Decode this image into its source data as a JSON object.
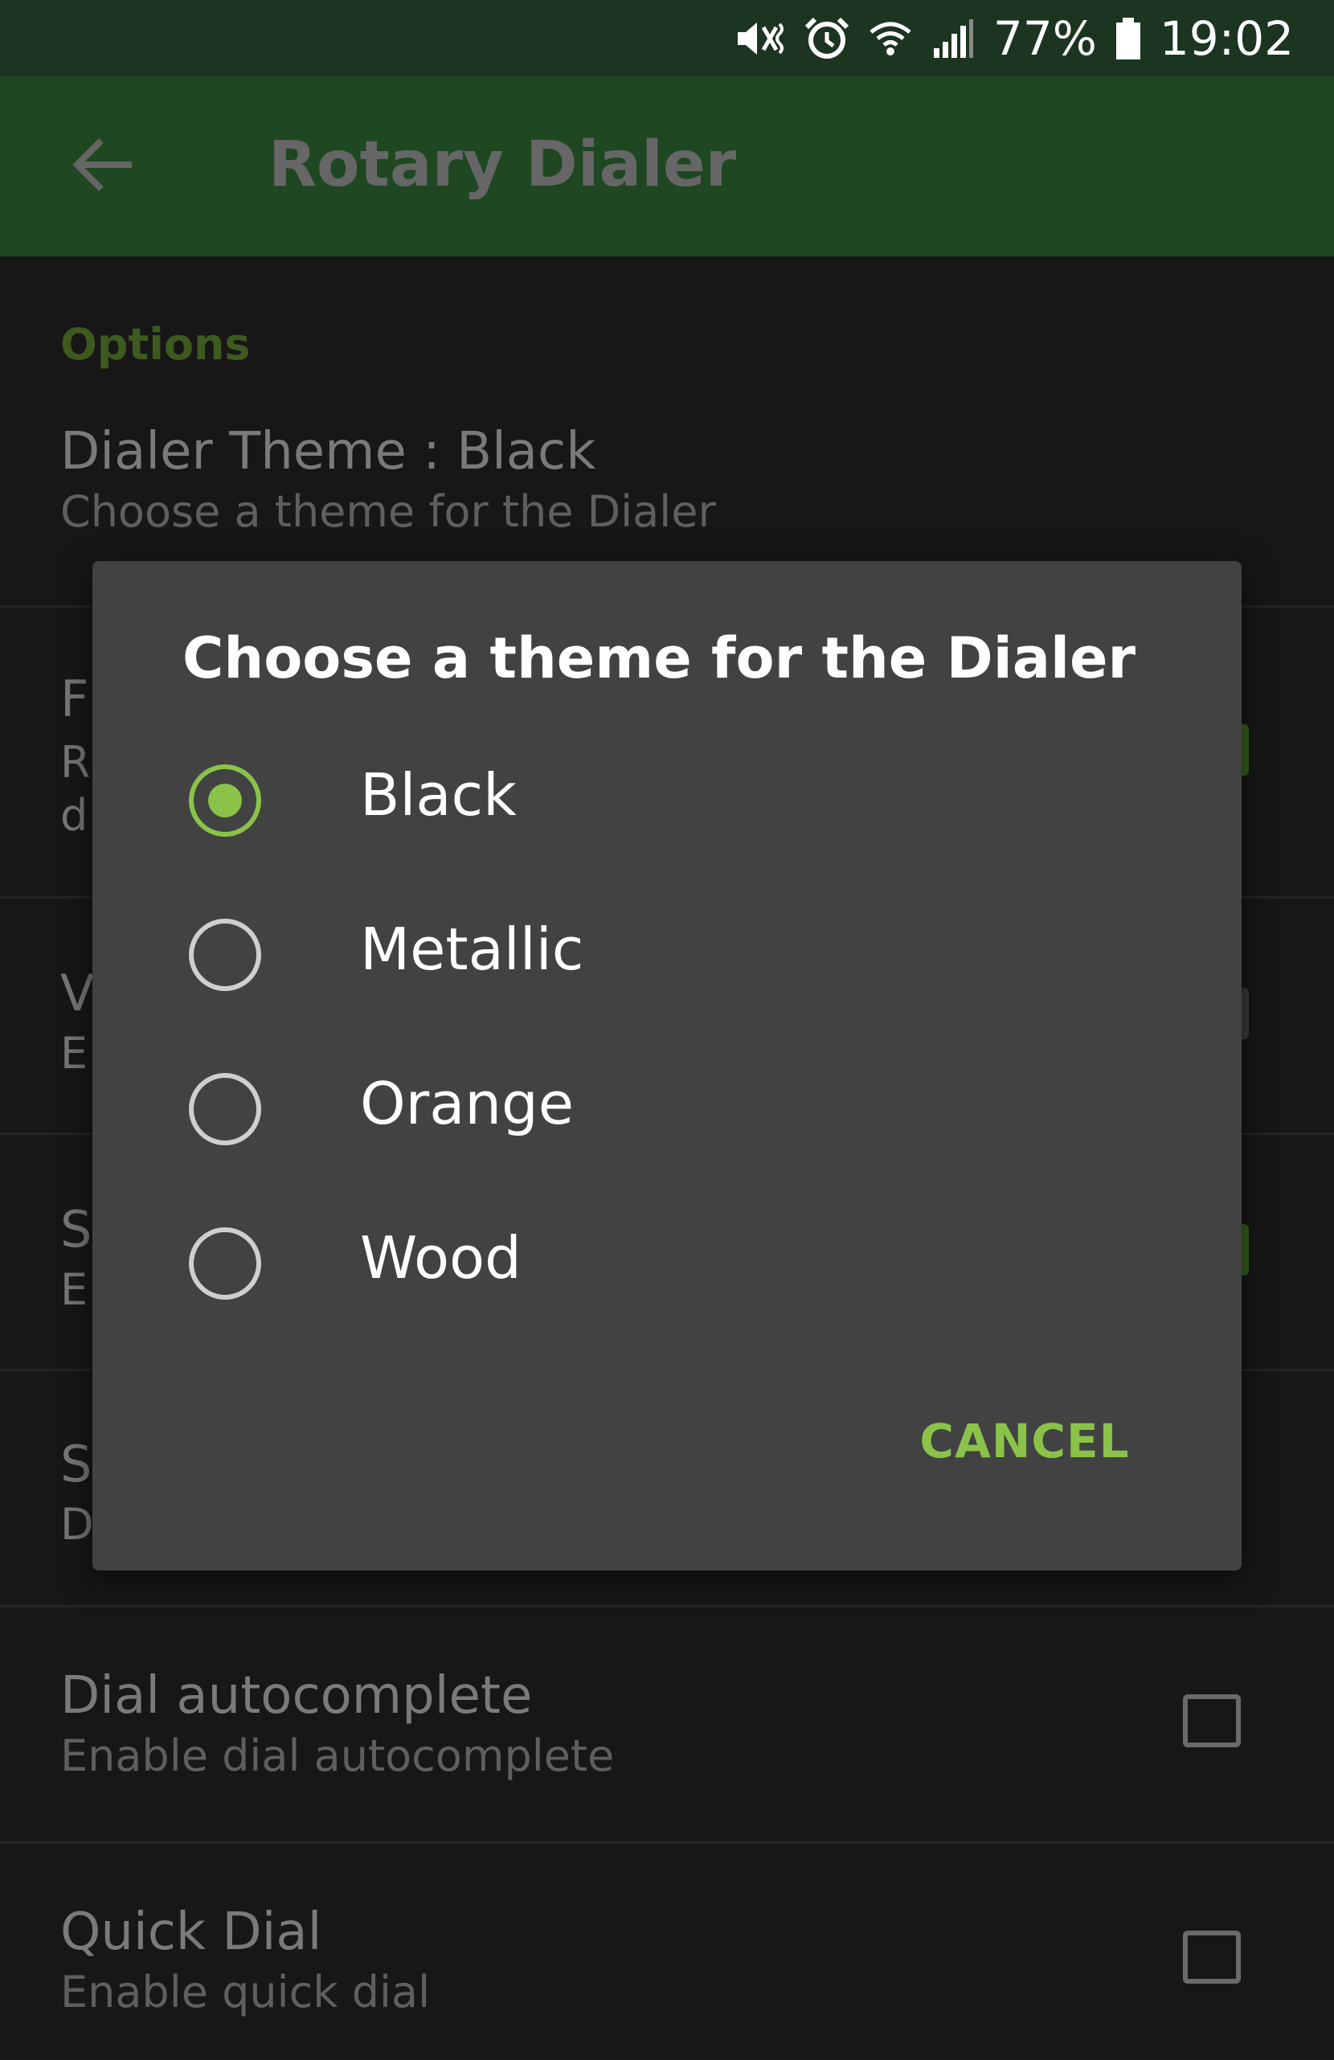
{
  "status_bar": {
    "icons": [
      "mute-vibrate-icon",
      "alarm-icon",
      "wifi-icon",
      "signal-icon",
      "battery-icon"
    ],
    "battery": "77%",
    "time": "19:02"
  },
  "app_bar": {
    "back_icon": "arrow-back-icon",
    "title": "Rotary Dialer"
  },
  "settings": {
    "section_header": "Options",
    "items": [
      {
        "title": "Dialer Theme : Black",
        "summary": "Choose a theme for the Dialer"
      },
      {
        "title_peek": "F",
        "summary_peek_1": "R",
        "summary_peek_2": "d"
      },
      {
        "title_peek": "V",
        "summary_peek_1": "E"
      },
      {
        "title_peek": "S",
        "summary_peek_1": "E"
      },
      {
        "title_peek": "S",
        "summary_peek_1": "D"
      },
      {
        "title": "Dial autocomplete",
        "summary": "Enable dial autocomplete",
        "checked": false
      },
      {
        "title": "Quick Dial",
        "summary": "Enable quick dial",
        "checked": false
      }
    ]
  },
  "dialog": {
    "title": "Choose a theme for the Dialer",
    "options": [
      {
        "label": "Black",
        "selected": true
      },
      {
        "label": "Metallic",
        "selected": false
      },
      {
        "label": "Orange",
        "selected": false
      },
      {
        "label": "Wood",
        "selected": false
      }
    ],
    "cancel_label": "CANCEL"
  },
  "colors": {
    "accent": "#8bc34a",
    "app_bar": "#1e4722",
    "status_bar": "#1c3520",
    "dialog_bg": "#424242"
  }
}
